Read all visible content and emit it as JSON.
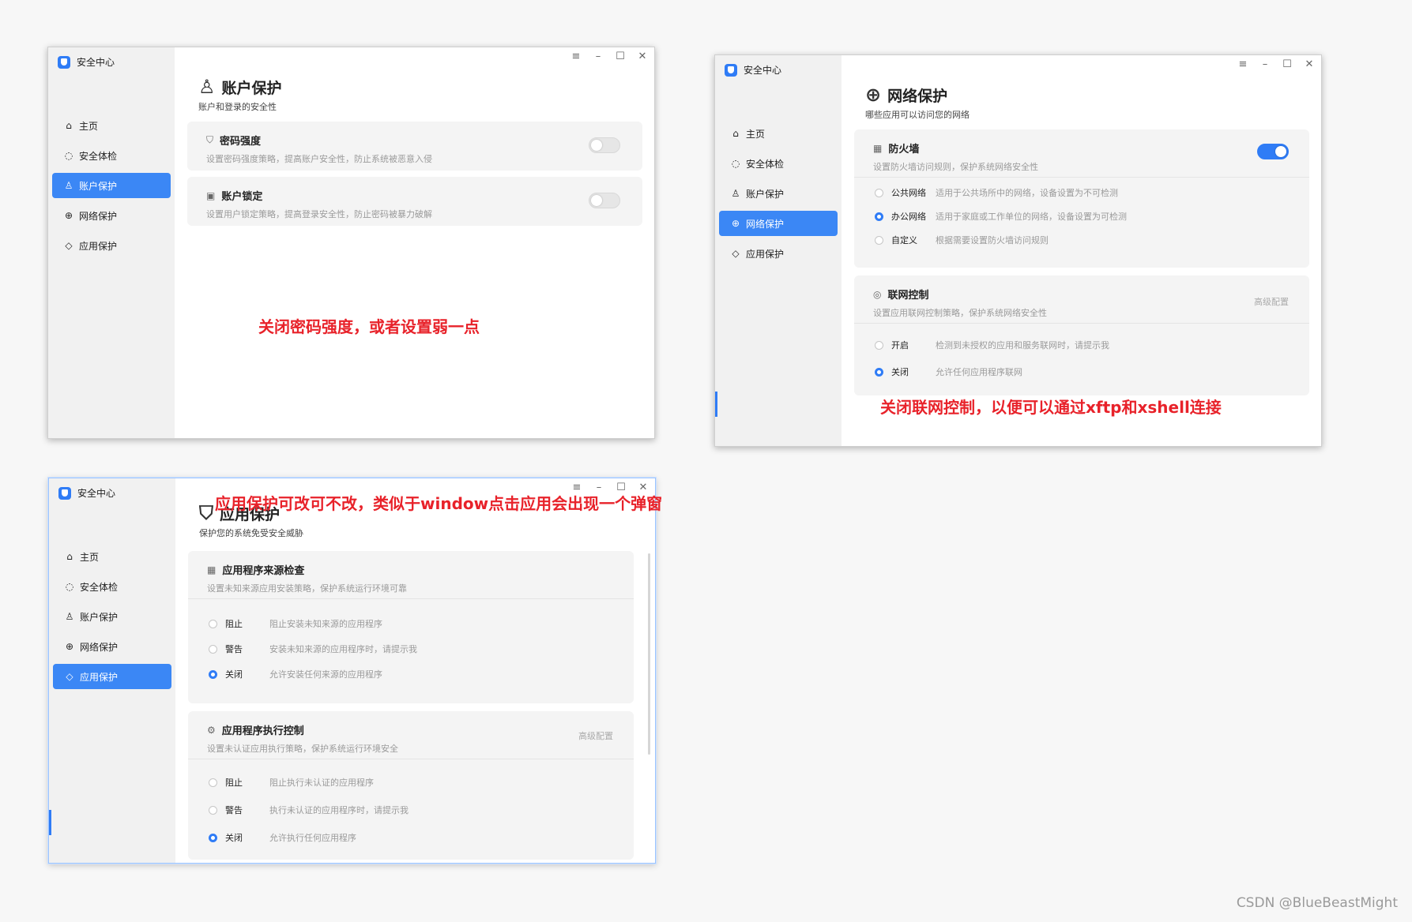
{
  "app_title": "安全中心",
  "nav": [
    {
      "label": "主页",
      "icon": "home-icon",
      "glyph": "⌂"
    },
    {
      "label": "安全体检",
      "icon": "scan-icon",
      "glyph": "◌"
    },
    {
      "label": "账户保护",
      "icon": "user-icon",
      "glyph": "♙"
    },
    {
      "label": "网络保护",
      "icon": "globe-icon",
      "glyph": "⊕"
    },
    {
      "label": "应用保护",
      "icon": "shield-icon",
      "glyph": "◇"
    }
  ],
  "window_controls": {
    "menu": "≡",
    "minimize": "–",
    "maximize": "☐",
    "close": "✕"
  },
  "accent_color": "#3b87f5",
  "annotation_color": "#e8222a",
  "win1": {
    "active_nav": "账户保护",
    "title": "账户保护",
    "subtitle": "账户和登录的安全性",
    "password": {
      "title": "密码强度",
      "desc": "设置密码强度策略，提高账户安全性，防止系统被恶意入侵",
      "enabled": false
    },
    "lockout": {
      "title": "账户锁定",
      "desc": "设置用户锁定策略，提高登录安全性，防止密码被暴力破解",
      "enabled": false
    },
    "annotation": "关闭密码强度，或者设置弱一点"
  },
  "win2": {
    "active_nav": "网络保护",
    "title": "网络保护",
    "subtitle": "哪些应用可以访问您的网络",
    "firewall": {
      "title": "防火墙",
      "desc": "设置防火墙访问规则，保护系统网络安全性",
      "enabled": true,
      "options": [
        {
          "label": "公共网络",
          "desc": "适用于公共场所中的网络，设备设置为不可检测",
          "checked": false
        },
        {
          "label": "办公网络",
          "desc": "适用于家庭或工作单位的网络，设备设置为可检测",
          "checked": true
        },
        {
          "label": "自定义",
          "desc": "根据需要设置防火墙访问规则",
          "checked": false
        }
      ]
    },
    "netctl": {
      "title": "联网控制",
      "desc": "设置应用联网控制策略，保护系统网络安全性",
      "advanced": "高级配置",
      "options": [
        {
          "label": "开启",
          "desc": "检测到未授权的应用和服务联网时，请提示我",
          "checked": false
        },
        {
          "label": "关闭",
          "desc": "允许任何应用程序联网",
          "checked": true
        }
      ]
    },
    "annotation": "关闭联网控制，以便可以通过xftp和xshell连接"
  },
  "win3": {
    "active_nav": "应用保护",
    "title": "应用保护",
    "subtitle": "保护您的系统免受安全威胁",
    "source": {
      "title": "应用程序来源检查",
      "desc": "设置未知来源应用安装策略，保护系统运行环境可靠",
      "options": [
        {
          "label": "阻止",
          "desc": "阻止安装未知来源的应用程序",
          "checked": false
        },
        {
          "label": "警告",
          "desc": "安装未知来源的应用程序时，请提示我",
          "checked": false
        },
        {
          "label": "关闭",
          "desc": "允许安装任何来源的应用程序",
          "checked": true
        }
      ]
    },
    "exec": {
      "title": "应用程序执行控制",
      "desc": "设置未认证应用执行策略，保护系统运行环境安全",
      "advanced": "高级配置",
      "options": [
        {
          "label": "阻止",
          "desc": "阻止执行未认证的应用程序",
          "checked": false
        },
        {
          "label": "警告",
          "desc": "执行未认证的应用程序时，请提示我",
          "checked": false
        },
        {
          "label": "关闭",
          "desc": "允许执行任何应用程序",
          "checked": true
        }
      ]
    },
    "annotation": "应用保护可改可不改，类似于window点击应用会出现一个弹窗"
  },
  "watermark": "CSDN @BlueBeastMight"
}
